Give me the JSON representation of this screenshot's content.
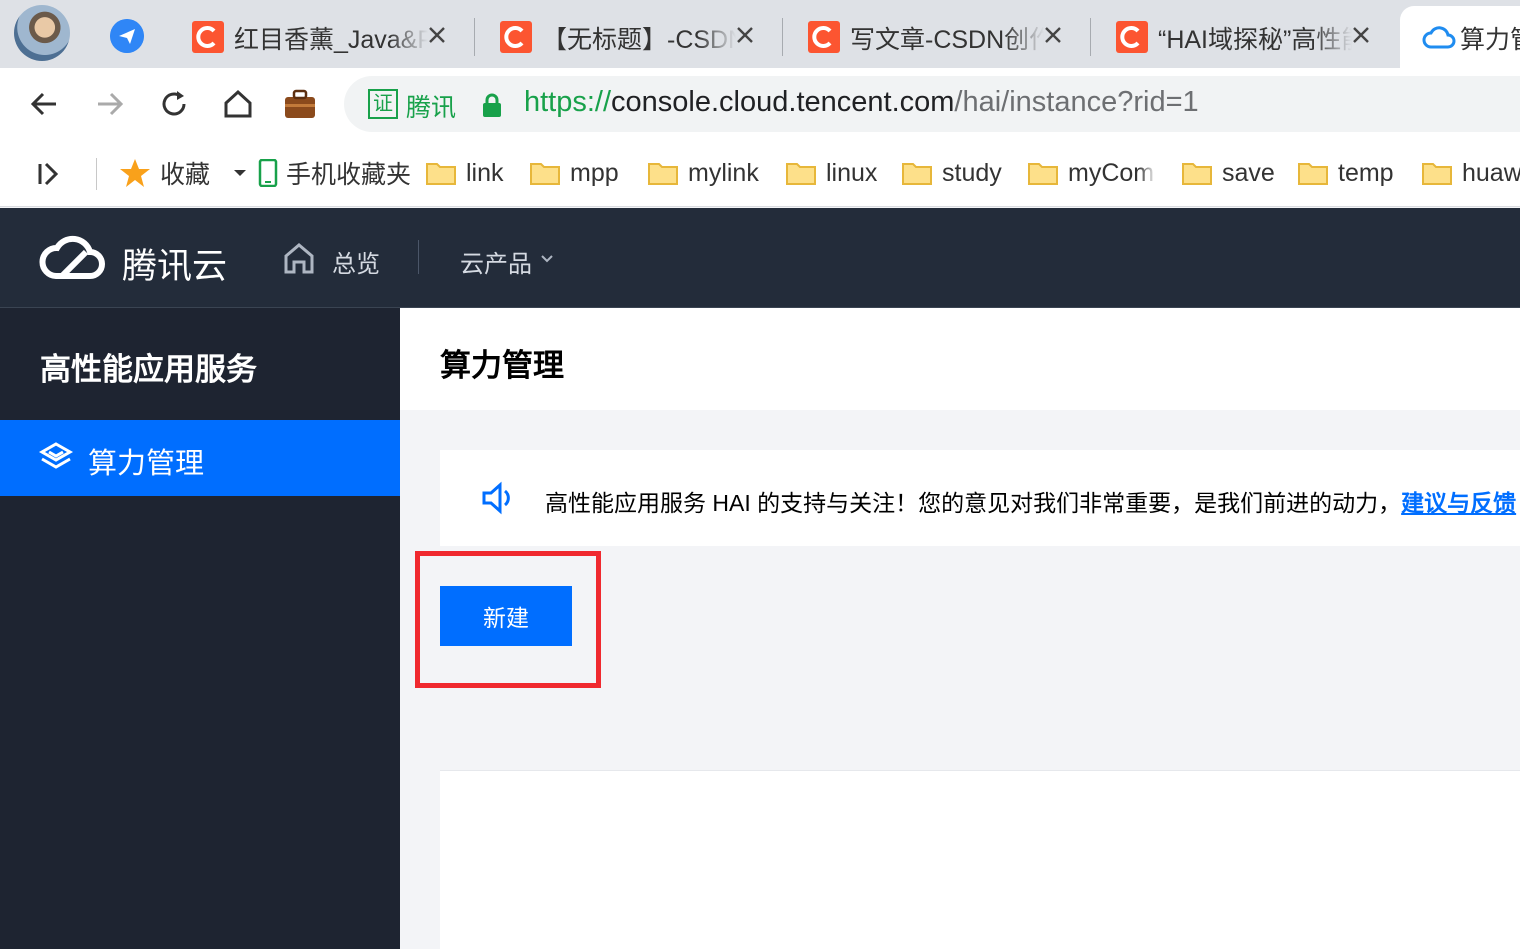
{
  "browser": {
    "tabs": [
      {
        "title": "红目香薰_Java&P",
        "icon": "csdn-icon"
      },
      {
        "title": "【无标题】-CSDN",
        "icon": "csdn-icon"
      },
      {
        "title": "写文章-CSDN创作",
        "icon": "csdn-icon"
      },
      {
        "title": "“HAI域探秘”高性能",
        "icon": "csdn-icon"
      },
      {
        "title": "算力管理",
        "icon": "tencent-cloud-icon",
        "active": true
      }
    ],
    "address": {
      "cert_badge": "证",
      "cert_org": "腾讯",
      "url_scheme": "https://",
      "url_host": "console.cloud.tencent.com",
      "url_path": "/hai/instance?rid=1"
    },
    "bookmarks": [
      {
        "label": "收藏",
        "icon": "star-icon"
      },
      {
        "label": "手机收藏夹",
        "icon": "phone-icon"
      },
      {
        "label": "link",
        "icon": "folder-icon"
      },
      {
        "label": "mpp",
        "icon": "folder-icon"
      },
      {
        "label": "mylink",
        "icon": "folder-icon"
      },
      {
        "label": "linux",
        "icon": "folder-icon"
      },
      {
        "label": "study",
        "icon": "folder-icon"
      },
      {
        "label": "myCom",
        "icon": "folder-icon"
      },
      {
        "label": "save",
        "icon": "folder-icon"
      },
      {
        "label": "temp",
        "icon": "folder-icon"
      },
      {
        "label": "huaw",
        "icon": "folder-icon"
      }
    ]
  },
  "console": {
    "brand": "腾讯云",
    "nav_overview": "总览",
    "nav_products": "云产品",
    "sidebar_title": "高性能应用服务",
    "sidebar_item": "算力管理",
    "page_title": "算力管理",
    "notice_text": "高性能应用服务 HAI 的支持与关注！您的意见对我们非常重要，是我们前进的动力，",
    "notice_link": "建议与反馈",
    "create_button": "新建"
  },
  "colors": {
    "accent": "#006eff",
    "topnav_bg": "#232c3a",
    "sidebar_bg": "#1e2431",
    "highlight": "#f0292f",
    "csdn": "#fc5531"
  }
}
